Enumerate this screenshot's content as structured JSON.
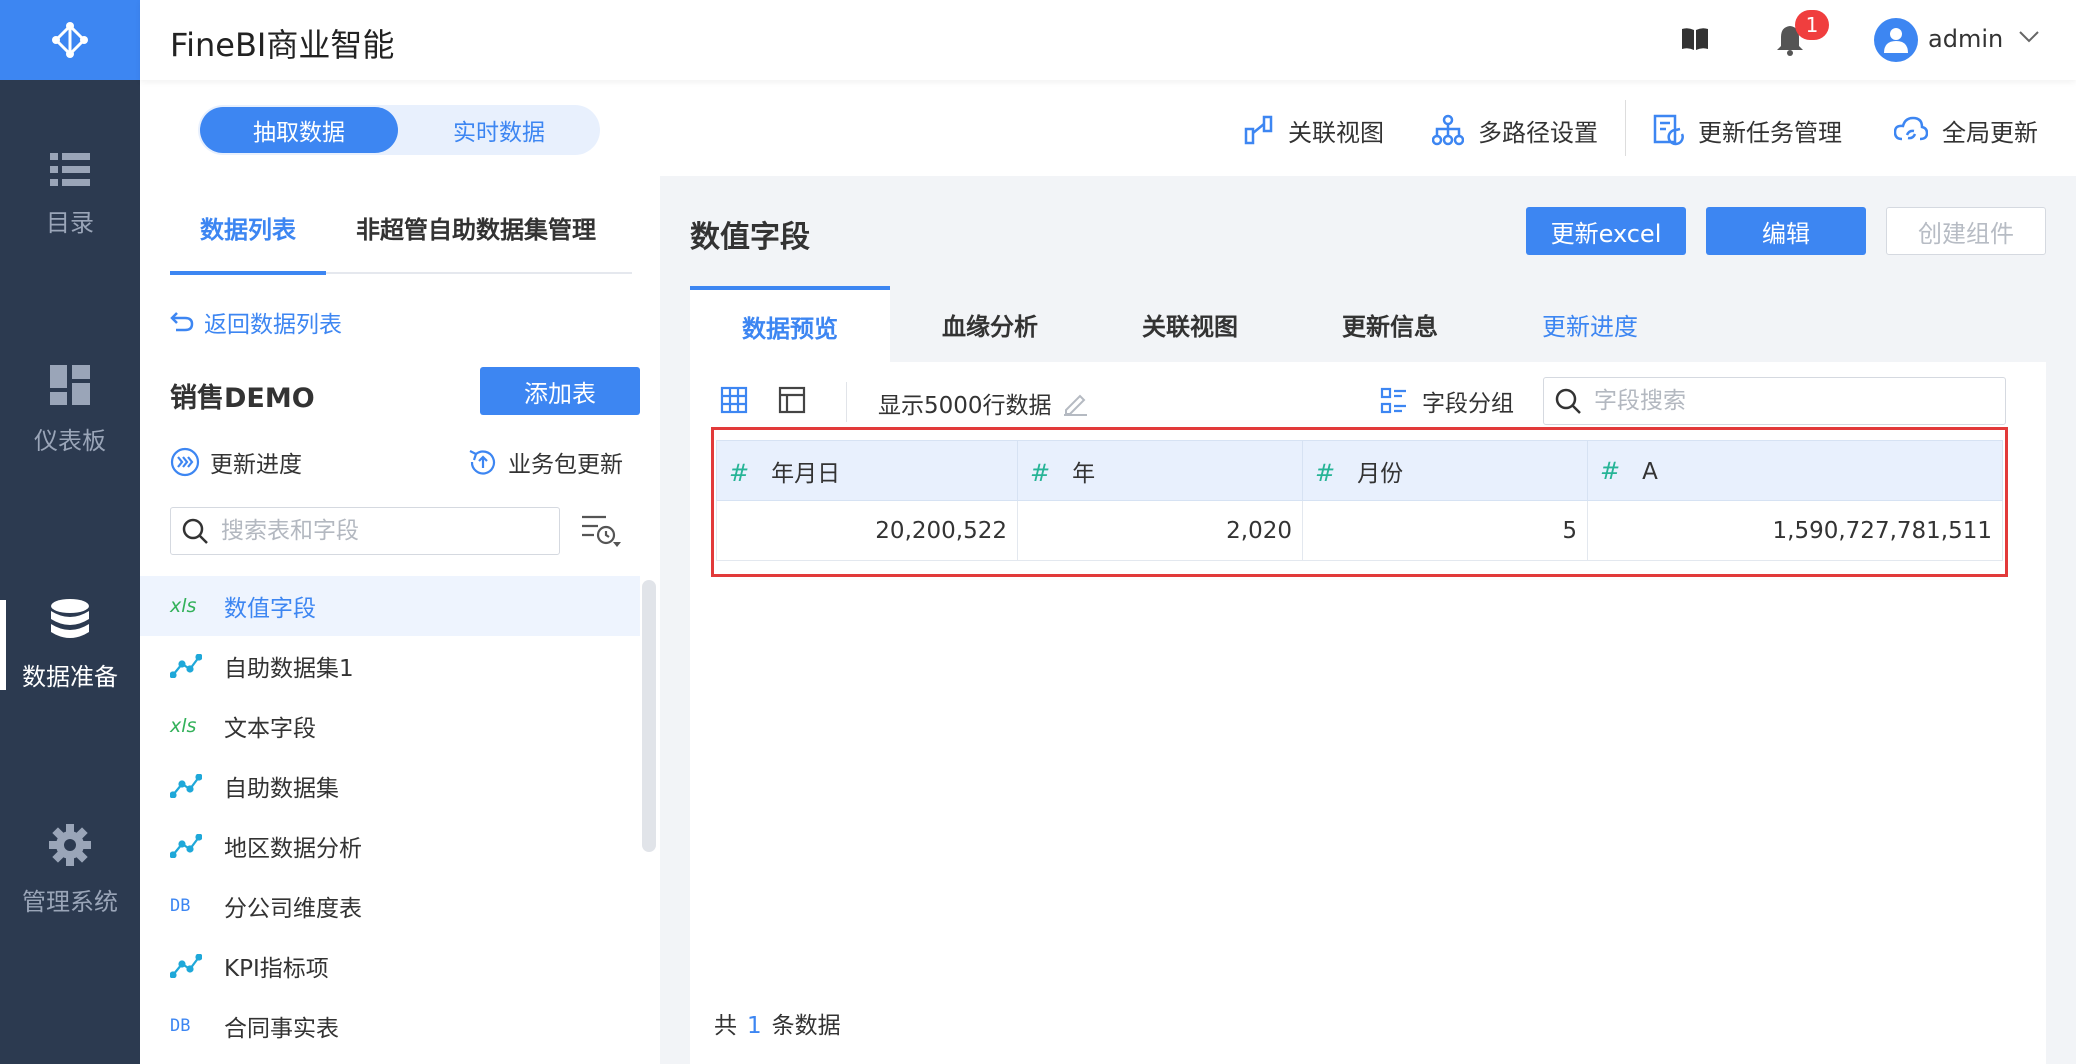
{
  "app": {
    "title": "FineBI商业智能"
  },
  "header": {
    "notification_count": "1",
    "username": "admin"
  },
  "nav": [
    {
      "label": "目录",
      "icon": "list-icon"
    },
    {
      "label": "仪表板",
      "icon": "dashboard-icon"
    },
    {
      "label": "数据准备",
      "icon": "database-icon",
      "active": true
    },
    {
      "label": "管理系统",
      "icon": "gear-icon"
    }
  ],
  "mode_toggle": {
    "extract": "抽取数据",
    "realtime": "实时数据"
  },
  "toolbar": {
    "relation_view": "关联视图",
    "multi_path": "多路径设置",
    "task_manage": "更新任务管理",
    "global_update": "全局更新"
  },
  "left_panel": {
    "tab_data_list": "数据列表",
    "tab_non_admin": "非超管自助数据集管理",
    "back": "返回数据列表",
    "package_name": "销售DEMO",
    "add_table": "添加表",
    "update_progress": "更新进度",
    "package_update": "业务包更新",
    "search_placeholder": "搜索表和字段",
    "tables": [
      {
        "name": "数值字段",
        "type": "xls",
        "icon_text": "xls",
        "selected": true
      },
      {
        "name": "自助数据集1",
        "type": "self",
        "icon_text": ""
      },
      {
        "name": "文本字段",
        "type": "xls",
        "icon_text": "xls"
      },
      {
        "name": "自助数据集",
        "type": "self",
        "icon_text": ""
      },
      {
        "name": "地区数据分析",
        "type": "self",
        "icon_text": ""
      },
      {
        "name": "分公司维度表",
        "type": "db",
        "icon_text": "DB"
      },
      {
        "name": "KPI指标项",
        "type": "self",
        "icon_text": ""
      },
      {
        "name": "合同事实表",
        "type": "db",
        "icon_text": "DB"
      }
    ]
  },
  "content": {
    "title": "数值字段",
    "btn_update_excel": "更新excel",
    "btn_edit": "编辑",
    "btn_create_component": "创建组件",
    "tabs": [
      "数据预览",
      "血缘分析",
      "关联视图",
      "更新信息",
      "更新进度"
    ],
    "show_rows": "显示5000行数据",
    "field_group": "字段分组",
    "field_search_placeholder": "字段搜索",
    "columns": [
      {
        "type_icon": "#",
        "name": "年月日"
      },
      {
        "type_icon": "#",
        "name": "年"
      },
      {
        "type_icon": "#",
        "name": "月份"
      },
      {
        "type_icon": "#",
        "name": "A"
      }
    ],
    "rows": [
      [
        "20,200,522",
        "2,020",
        "5",
        "1,590,727,781,511"
      ]
    ],
    "total_prefix": "共",
    "total_count": "1",
    "total_suffix": "条数据"
  }
}
